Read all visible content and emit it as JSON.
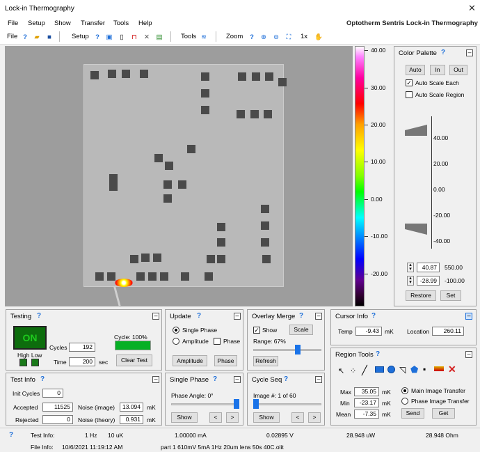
{
  "window": {
    "title": "Lock-in Thermography",
    "close": "✕"
  },
  "menu": {
    "items": [
      "File",
      "Setup",
      "Show",
      "Transfer",
      "Tools",
      "Help"
    ],
    "brand": "Optotherm Sentris Lock-in Thermography"
  },
  "toolbar": {
    "file": "File",
    "setup": "Setup",
    "tools": "Tools",
    "zoom": "Zoom",
    "zoom_level": "1x"
  },
  "colorbar": {
    "ticks": [
      "40.00",
      "30.00",
      "20.00",
      "10.00",
      "0.00",
      "-10.00",
      "-20.00"
    ]
  },
  "color_palette": {
    "title": "Color Palette",
    "auto": "Auto",
    "in": "In",
    "out": "Out",
    "auto_scale_each": "Auto Scale Each",
    "auto_scale_each_checked": true,
    "auto_scale_region": "Auto Scale Region",
    "auto_scale_region_checked": false,
    "scale_ticks": [
      "40.00",
      "20.00",
      "0.00",
      "-20.00",
      "-40.00"
    ],
    "upper_value": "40.87",
    "upper_extra": "550.00",
    "lower_value": "-28.99",
    "lower_extra": "-100.00",
    "restore": "Restore",
    "set": "Set"
  },
  "testing": {
    "title": "Testing",
    "on": "ON",
    "cycles_label": "Cycles",
    "cycles": "192",
    "time_label": "Time",
    "time": "200",
    "time_unit": "sec",
    "cycle_label": "Cycle: 100%",
    "progress": 1.0,
    "high_low": "High Low",
    "clear": "Clear Test"
  },
  "update": {
    "title": "Update",
    "single_phase": "Single Phase",
    "amplitude": "Amplitude",
    "phase": "Phase",
    "amplitude_btn": "Amplitude",
    "phase_btn": "Phase"
  },
  "overlay": {
    "title": "Overlay Merge",
    "show": "Show",
    "scale": "Scale",
    "range": "Range: 67%",
    "range_value": 0.67,
    "refresh": "Refresh"
  },
  "cursor": {
    "title": "Cursor Info",
    "temp_label": "Temp",
    "temp": "-9.43",
    "temp_unit": "mK",
    "loc_label": "Location",
    "loc": "260.11"
  },
  "test_info": {
    "title": "Test Info",
    "init_cycles_label": "Init Cycles",
    "init_cycles": "0",
    "accepted_label": "Accepted",
    "accepted": "11525",
    "noise_image_label": "Noise (image)",
    "noise_image": "13.094",
    "rejected_label": "Rejected",
    "rejected": "0",
    "noise_theory_label": "Noise (theory)",
    "noise_theory": "0.931",
    "unit": "mK"
  },
  "single_phase": {
    "title": "Single Phase",
    "angle": "Phase Angle: 0°",
    "show": "Show",
    "prev": "<",
    "next": ">"
  },
  "cycle_seq": {
    "title": "Cycle Seq",
    "image": "Image #: 1 of 60",
    "show": "Show",
    "prev": "<",
    "next": ">"
  },
  "region": {
    "title": "Region Tools",
    "max_label": "Max",
    "max": "35.05",
    "min_label": "Min",
    "min": "-23.17",
    "mean_label": "Mean",
    "mean": "-7.35",
    "unit": "mK",
    "main_transfer": "Main Image Transfer",
    "phase_transfer": "Phase Image Transfer",
    "send": "Send",
    "get": "Get"
  },
  "status": {
    "test_info_label": "Test Info:",
    "freq": "1 Hz",
    "uk": "10 uK",
    "current": "1.00000 mA",
    "voltage": "0.02895 V",
    "power": "28.948 uW",
    "ohm": "28.948 Ohm",
    "file_info_label": "File Info:",
    "date": "10/6/2021 11:19:12 AM",
    "file": "part 1 610mV 5mA 1Hz 20um lens 50s 40C.olit"
  }
}
